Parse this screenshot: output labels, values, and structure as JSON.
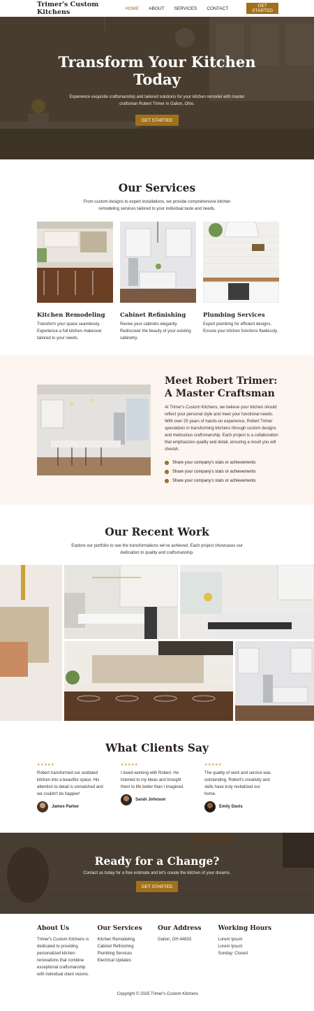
{
  "nav": {
    "brand": "Trimer's Custom Kitchens",
    "links": [
      "HOME",
      "ABOUT",
      "SERVICES",
      "CONTACT"
    ],
    "cta": "GET STARTED"
  },
  "hero": {
    "title_line1": "Transform Your Kitchen",
    "title_line2": "Today",
    "subtitle": "Experience exquisite craftsmanship and tailored solutions for your kitchen remodel with master craftsman Robert Trimer in Galion, Ohio.",
    "cta": "GET STARTED"
  },
  "services": {
    "title": "Our Services",
    "subtitle": "From custom designs to expert installations, we provide comprehensive kitchen remodeling services tailored to your individual taste and needs.",
    "cards": [
      {
        "title": "Kitchen Remodeling",
        "text": "Transform your space seamlessly. Experience a full kitchen makeover tailored to your needs."
      },
      {
        "title": "Cabinet Refinishing",
        "text": "Revive your cabinets elegantly. Rediscover the beauty of your existing cabinetry."
      },
      {
        "title": "Plumbing Services",
        "text": "Expert plumbing for efficient designs. Ensure your kitchen functions flawlessly."
      }
    ]
  },
  "meet": {
    "title": "Meet Robert Trimer: A Master Craftsman",
    "text": "At Trimer's Custom Kitchens, we believe your kitchen should reflect your personal style and meet your functional needs. With over 25 years of hands-on experience, Robert Trimer specializes in transforming kitchens through custom designs and meticulous craftsmanship. Each project is a collaboration that emphasizes quality and detail, ensuring a result you will cherish.",
    "stats": [
      "Share your company's stats or achievements",
      "Share your company's stats or achievements",
      "Share your company's stats or achievements"
    ]
  },
  "work": {
    "title": "Our Recent Work",
    "subtitle": "Explore our portfolio to see the transformations we've achieved. Each project showcases our dedication to quality and craftsmanship."
  },
  "clients": {
    "title": "What Clients Say",
    "stars": "★★★★★",
    "items": [
      {
        "text": "Robert transformed our outdated kitchen into a beautiful space. His attention to detail is unmatched and we couldn't be happier!",
        "name": "James Parker"
      },
      {
        "text": "I loved working with Robert. He listened to my ideas and brought them to life better than I imagined.",
        "name": "Sarah Johnson"
      },
      {
        "text": "The quality of work and service was outstanding. Robert's creativity and skills have truly revitalized our home.",
        "name": "Emily Davis"
      }
    ]
  },
  "cta": {
    "title": "Ready for a Change?",
    "text": "Contact us today for a free estimate and let's create the kitchen of your dreams.",
    "button": "GET STARTED"
  },
  "footer": {
    "about_title": "About Us",
    "about_text": "Trimer's Custom Kitchens is dedicated to providing personalized kitchen renovations that combine exceptional craftsmanship with individual client visions.",
    "services_title": "Our Services",
    "services": [
      "Kitchen Remodeling",
      "Cabinet Refinishing",
      "Plumbing Services",
      "Electrical Updates"
    ],
    "address_title": "Our Address",
    "address": "Galion, OH 44833",
    "hours_title": "Working Hours",
    "hours": [
      "Lorem Ipsum",
      "Lorem Ipsum",
      "Sunday: Closed"
    ],
    "copyright": "Copyright © 2025 Trimer's Custom Kitchens"
  }
}
